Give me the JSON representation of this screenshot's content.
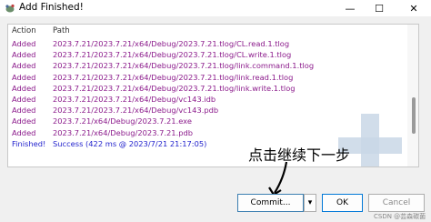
{
  "window": {
    "title": "Add Finished!",
    "minimize": "—",
    "maximize": "☐",
    "close": "✕"
  },
  "log": {
    "columns": [
      "Action",
      "Path"
    ],
    "rows": [
      {
        "action": "Added",
        "path": "2023.7.21/2023.7.21/x64/Debug/2023.7.21.tlog/CL.read.1.tlog",
        "type": "added"
      },
      {
        "action": "Added",
        "path": "2023.7.21/2023.7.21/x64/Debug/2023.7.21.tlog/CL.write.1.tlog",
        "type": "added"
      },
      {
        "action": "Added",
        "path": "2023.7.21/2023.7.21/x64/Debug/2023.7.21.tlog/link.command.1.tlog",
        "type": "added"
      },
      {
        "action": "Added",
        "path": "2023.7.21/2023.7.21/x64/Debug/2023.7.21.tlog/link.read.1.tlog",
        "type": "added"
      },
      {
        "action": "Added",
        "path": "2023.7.21/2023.7.21/x64/Debug/2023.7.21.tlog/link.write.1.tlog",
        "type": "added"
      },
      {
        "action": "Added",
        "path": "2023.7.21/2023.7.21/x64/Debug/vc143.idb",
        "type": "added"
      },
      {
        "action": "Added",
        "path": "2023.7.21/2023.7.21/x64/Debug/vc143.pdb",
        "type": "added"
      },
      {
        "action": "Added",
        "path": "2023.7.21/x64/Debug/2023.7.21.exe",
        "type": "added"
      },
      {
        "action": "Added",
        "path": "2023.7.21/x64/Debug/2023.7.21.pdb",
        "type": "added"
      },
      {
        "action": "Finished!",
        "path": "Success (422 ms @ 2023/7/21 21:17:05)",
        "type": "finished"
      }
    ]
  },
  "annotation": "点击继续下一步",
  "buttons": {
    "commit": "Commit...",
    "split": "▾",
    "ok": "OK",
    "cancel": "Cancel"
  },
  "watermark": "CSDN @芸森碳菌",
  "colors": {
    "added": "#8b1a8b",
    "finished": "#1f1fcc"
  }
}
